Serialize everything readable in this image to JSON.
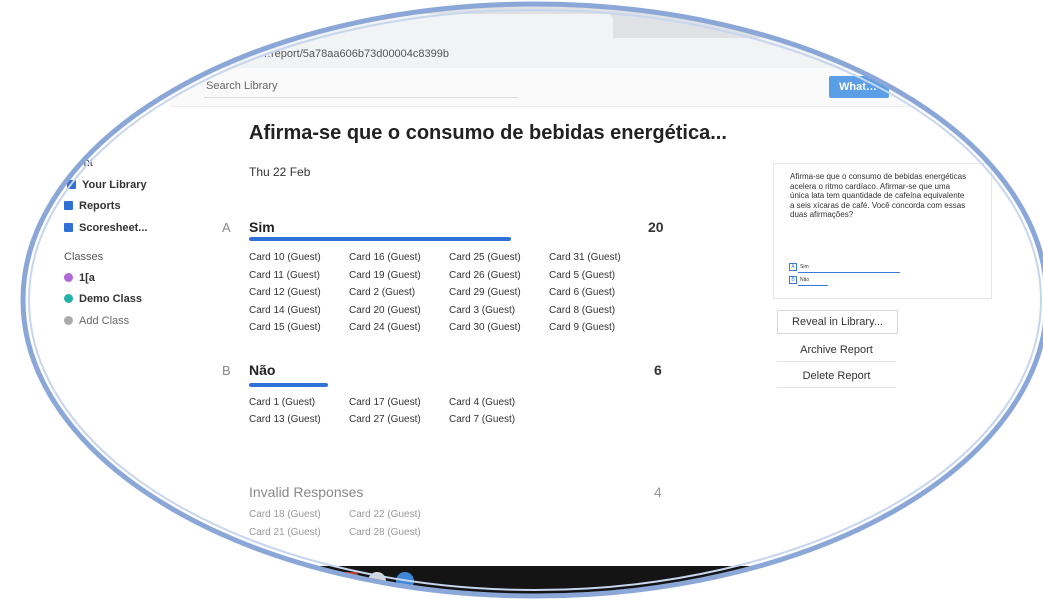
{
  "browser": {
    "url": "…report/5a78aa606b73d00004c8399b"
  },
  "appbar": {
    "search_placeholder": "Search Library",
    "whats_button": "What…"
  },
  "sidebar": {
    "items": [
      {
        "label": "Recent"
      },
      {
        "label": "Your Library"
      },
      {
        "label": "Reports"
      },
      {
        "label": "Scoresheet..."
      }
    ],
    "classes_heading": "Classes",
    "classes": [
      {
        "label": "1[a",
        "color": "#b06ad6"
      },
      {
        "label": "Demo Class",
        "color": "#23b2a8"
      }
    ],
    "add_class": "Add Class"
  },
  "report": {
    "title": "Afirma-se que o consumo de bebidas energética...",
    "date": "Thu 22 Feb",
    "answers": [
      {
        "letter": "A",
        "label": "Sim",
        "count": "20",
        "fraction": 0.667,
        "cards": [
          "Card 10 (Guest)",
          "Card 16 (Guest)",
          "Card 25 (Guest)",
          "Card 31 (Guest)",
          "Card 11 (Guest)",
          "Card 19 (Guest)",
          "Card 26 (Guest)",
          "Card 5 (Guest)",
          "Card 12 (Guest)",
          "Card 2 (Guest)",
          "Card 29 (Guest)",
          "Card 6 (Guest)",
          "Card 14 (Guest)",
          "Card 20 (Guest)",
          "Card 3 (Guest)",
          "Card 8 (Guest)",
          "Card 15 (Guest)",
          "Card 24 (Guest)",
          "Card 30 (Guest)",
          "Card 9 (Guest)"
        ]
      },
      {
        "letter": "B",
        "label": "Não",
        "count": "6",
        "fraction": 0.2,
        "cards": [
          "Card 1 (Guest)",
          "Card 17 (Guest)",
          "Card 4 (Guest)",
          "Card 13 (Guest)",
          "Card 27 (Guest)",
          "Card 7 (Guest)"
        ]
      }
    ],
    "invalid": {
      "label": "Invalid Responses",
      "count": "4",
      "cards": [
        "Card 18 (Guest)",
        "Card 22 (Guest)",
        "Card 21 (Guest)",
        "Card 28 (Guest)"
      ]
    }
  },
  "question_panel": {
    "text": "Afirma-se que o consumo de bebidas energéticas acelera o ritmo cardíaco. Afirmar-se que uma única lata tem quantidade de cafeína equivalente a seis xícaras de café. Você concorda com essas duas afirmações?",
    "options": [
      {
        "letter": "A",
        "label": "Sim"
      },
      {
        "letter": "B",
        "label": "Não"
      }
    ]
  },
  "actions": {
    "reveal": "Reveal in Library...",
    "archive": "Archive Report",
    "delete": "Delete Report"
  },
  "colors": {
    "accent": "#2f73d8",
    "lens_border": "#8aa7d8"
  }
}
